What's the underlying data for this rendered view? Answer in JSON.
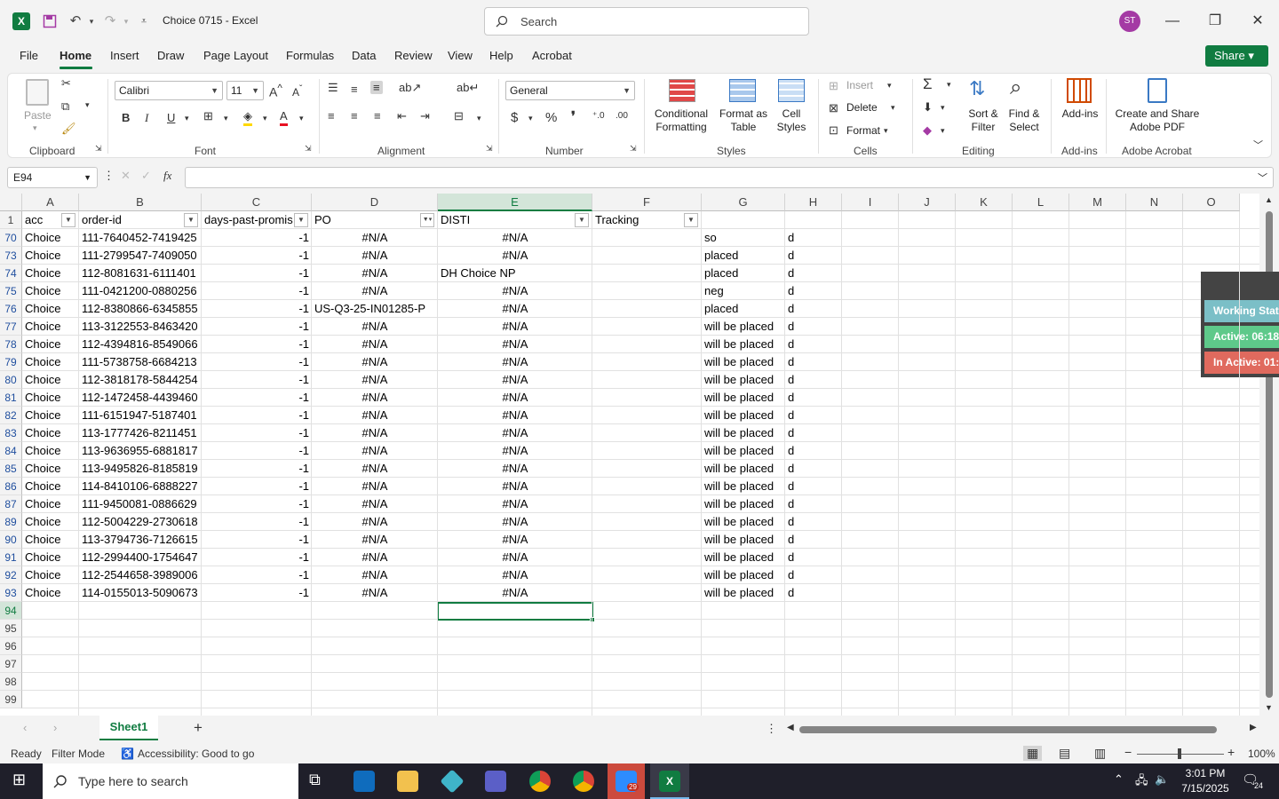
{
  "window": {
    "title": "Choice 0715  -  Excel",
    "search_placeholder": "Search",
    "avatar": "ST"
  },
  "tabs": [
    "File",
    "Home",
    "Insert",
    "Draw",
    "Page Layout",
    "Formulas",
    "Data",
    "Review",
    "View",
    "Help",
    "Acrobat"
  ],
  "share_label": "Share",
  "ribbon": {
    "clipboard": {
      "paste": "Paste",
      "label": "Clipboard"
    },
    "font": {
      "name": "Calibri",
      "size": "11",
      "label": "Font"
    },
    "alignment": {
      "label": "Alignment"
    },
    "number": {
      "format": "General",
      "label": "Number"
    },
    "styles": {
      "conditional": "Conditional Formatting",
      "format_table": "Format as Table",
      "cell_styles": "Cell Styles",
      "label": "Styles"
    },
    "cells": {
      "insert": "Insert",
      "delete": "Delete",
      "format": "Format",
      "label": "Cells"
    },
    "editing": {
      "sort": "Sort & Filter",
      "find": "Find & Select",
      "label": "Editing"
    },
    "addins": {
      "addins": "Add-ins",
      "label": "Add-ins"
    },
    "acrobat": {
      "create": "Create and Share Adobe PDF",
      "label": "Adobe Acrobat"
    }
  },
  "formula_bar": {
    "name_box": "E94",
    "content": ""
  },
  "columns": [
    "A",
    "B",
    "C",
    "D",
    "E",
    "F",
    "G",
    "H",
    "I",
    "J",
    "K",
    "L",
    "M",
    "N",
    "O"
  ],
  "header_row": {
    "num": "1",
    "cells": [
      "acc",
      "order-id",
      "days-past-promis",
      "PO",
      "DISTI",
      "Tracking"
    ]
  },
  "rows": [
    {
      "num": "70",
      "acc": "Choice",
      "order": "111-7640452-7419425",
      "days": "-1",
      "po": "#N/A",
      "disti": "#N/A",
      "g": "so",
      "h": "d"
    },
    {
      "num": "73",
      "acc": "Choice",
      "order": "111-2799547-7409050",
      "days": "-1",
      "po": "#N/A",
      "disti": "#N/A",
      "g": "placed",
      "h": "d"
    },
    {
      "num": "74",
      "acc": "Choice",
      "order": "112-8081631-6111401",
      "days": "-1",
      "po": "#N/A",
      "disti": "DH Choice NP",
      "g": "placed",
      "h": "d"
    },
    {
      "num": "75",
      "acc": "Choice",
      "order": "111-0421200-0880256",
      "days": "-1",
      "po": "#N/A",
      "disti": "#N/A",
      "g": "neg",
      "h": "d"
    },
    {
      "num": "76",
      "acc": "Choice",
      "order": "112-8380866-6345855",
      "days": "-1",
      "po": "US-Q3-25-IN01285-P",
      "disti": "#N/A",
      "g": "placed",
      "h": "d"
    },
    {
      "num": "77",
      "acc": "Choice",
      "order": "113-3122553-8463420",
      "days": "-1",
      "po": "#N/A",
      "disti": "#N/A",
      "g": "will be placed",
      "h": "d"
    },
    {
      "num": "78",
      "acc": "Choice",
      "order": "112-4394816-8549066",
      "days": "-1",
      "po": "#N/A",
      "disti": "#N/A",
      "g": "will be placed",
      "h": "d"
    },
    {
      "num": "79",
      "acc": "Choice",
      "order": "111-5738758-6684213",
      "days": "-1",
      "po": "#N/A",
      "disti": "#N/A",
      "g": "will be placed",
      "h": "d"
    },
    {
      "num": "80",
      "acc": "Choice",
      "order": "112-3818178-5844254",
      "days": "-1",
      "po": "#N/A",
      "disti": "#N/A",
      "g": "will be placed",
      "h": "d"
    },
    {
      "num": "81",
      "acc": "Choice",
      "order": "112-1472458-4439460",
      "days": "-1",
      "po": "#N/A",
      "disti": "#N/A",
      "g": "will be placed",
      "h": "d"
    },
    {
      "num": "82",
      "acc": "Choice",
      "order": "111-6151947-5187401",
      "days": "-1",
      "po": "#N/A",
      "disti": "#N/A",
      "g": "will be placed",
      "h": "d"
    },
    {
      "num": "83",
      "acc": "Choice",
      "order": "113-1777426-8211451",
      "days": "-1",
      "po": "#N/A",
      "disti": "#N/A",
      "g": "will be placed",
      "h": "d"
    },
    {
      "num": "84",
      "acc": "Choice",
      "order": "113-9636955-6881817",
      "days": "-1",
      "po": "#N/A",
      "disti": "#N/A",
      "g": "will be placed",
      "h": "d"
    },
    {
      "num": "85",
      "acc": "Choice",
      "order": "113-9495826-8185819",
      "days": "-1",
      "po": "#N/A",
      "disti": "#N/A",
      "g": "will be placed",
      "h": "d"
    },
    {
      "num": "86",
      "acc": "Choice",
      "order": "114-8410106-6888227",
      "days": "-1",
      "po": "#N/A",
      "disti": "#N/A",
      "g": "will be placed",
      "h": "d"
    },
    {
      "num": "87",
      "acc": "Choice",
      "order": "111-9450081-0886629",
      "days": "-1",
      "po": "#N/A",
      "disti": "#N/A",
      "g": "will be placed",
      "h": "d"
    },
    {
      "num": "89",
      "acc": "Choice",
      "order": "112-5004229-2730618",
      "days": "-1",
      "po": "#N/A",
      "disti": "#N/A",
      "g": "will be placed",
      "h": "d"
    },
    {
      "num": "90",
      "acc": "Choice",
      "order": "113-3794736-7126615",
      "days": "-1",
      "po": "#N/A",
      "disti": "#N/A",
      "g": "will be placed",
      "h": "d"
    },
    {
      "num": "91",
      "acc": "Choice",
      "order": "112-2994400-1754647",
      "days": "-1",
      "po": "#N/A",
      "disti": "#N/A",
      "g": "will be placed",
      "h": "d"
    },
    {
      "num": "92",
      "acc": "Choice",
      "order": "112-2544658-3989006",
      "days": "-1",
      "po": "#N/A",
      "disti": "#N/A",
      "g": "will be placed",
      "h": "d"
    },
    {
      "num": "93",
      "acc": "Choice",
      "order": "114-0155013-5090673",
      "days": "-1",
      "po": "#N/A",
      "disti": "#N/A",
      "g": "will be placed",
      "h": "d"
    }
  ],
  "empty_rows": [
    "94",
    "95",
    "96",
    "97",
    "98",
    "99"
  ],
  "working_status": {
    "title": "Working Stat",
    "active": "Active: 06:18",
    "inactive": "In Active: 01:"
  },
  "sheet_tab": "Sheet1",
  "status": {
    "ready": "Ready",
    "mode": "Filter Mode",
    "accessibility": "Accessibility: Good to go",
    "zoom": "100%"
  },
  "taskbar": {
    "search_placeholder": "Type here to search",
    "time": "3:01 PM",
    "date": "7/15/2025",
    "notif": "24",
    "zoom_badge": "29"
  }
}
